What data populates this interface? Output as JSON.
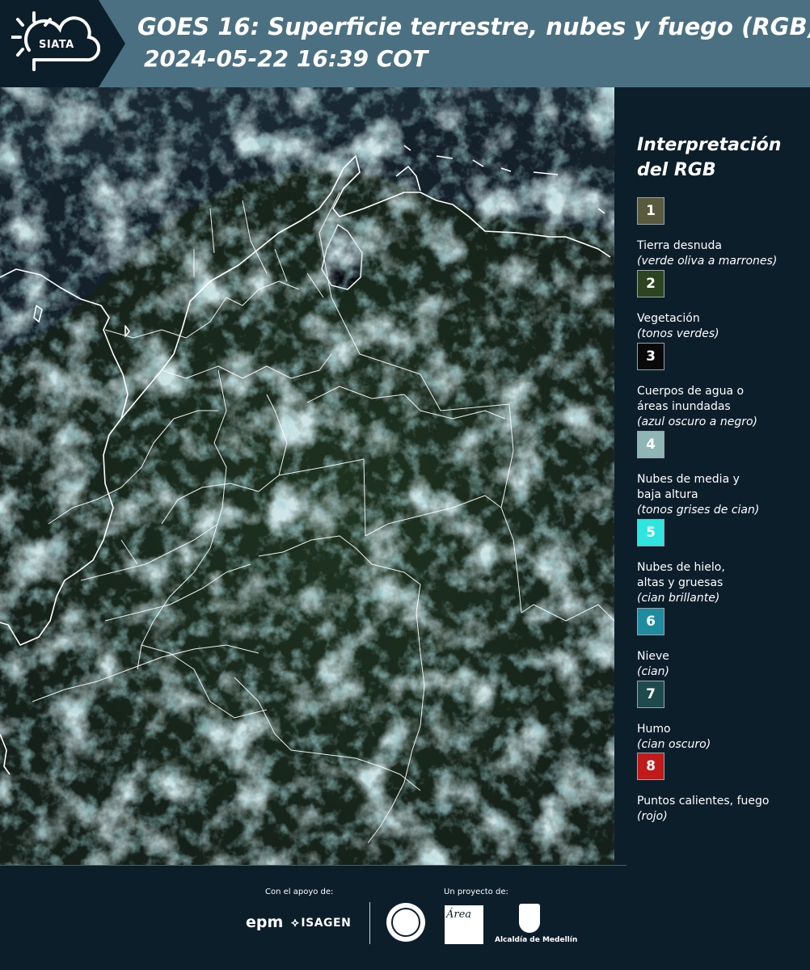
{
  "header": {
    "logo_text": "SIATA",
    "title_line1": "GOES 16: Superficie terrestre, nubes y fuego (RGB)",
    "title_line2": "2024-05-22 16:39 COT",
    "background_color": "#4b7082"
  },
  "legend": {
    "title": "Interpretación del RGB",
    "items": [
      {
        "number": "1",
        "name": "Tierra desnuda",
        "sub": "(verde oliva a marrones)",
        "color": "#5a5a3e"
      },
      {
        "number": "2",
        "name": "Vegetación",
        "sub": "(tonos verdes)",
        "color": "#2d4420"
      },
      {
        "number": "3",
        "name": "Cuerpos de agua o áreas inundadas",
        "sub": "(azul oscuro a negro)",
        "color": "#0a0a0a"
      },
      {
        "number": "4",
        "name": "Nubes de media y baja altura",
        "sub": "(tonos grises de cian)",
        "color": "#8fb5b5"
      },
      {
        "number": "5",
        "name": "Nubes de hielo, altas y gruesas",
        "sub": "(cian brillante)",
        "color": "#2ee5e0"
      },
      {
        "number": "6",
        "name": "Nieve",
        "sub": "(cian)",
        "color": "#1e8ba0"
      },
      {
        "number": "7",
        "name": "Humo",
        "sub": "(cian oscuro)",
        "color": "#1e4a4e"
      },
      {
        "number": "8",
        "name": "Puntos calientes, fuego",
        "sub": "(rojo)",
        "color": "#c01a1a"
      }
    ]
  },
  "footer": {
    "support_label": "Con el apoyo de:",
    "project_label": "Un proyecto de:",
    "sponsors": [
      "epm",
      "ISAGEN"
    ],
    "partners_text": [
      "Área",
      "Alcaldía de Medellín"
    ]
  }
}
